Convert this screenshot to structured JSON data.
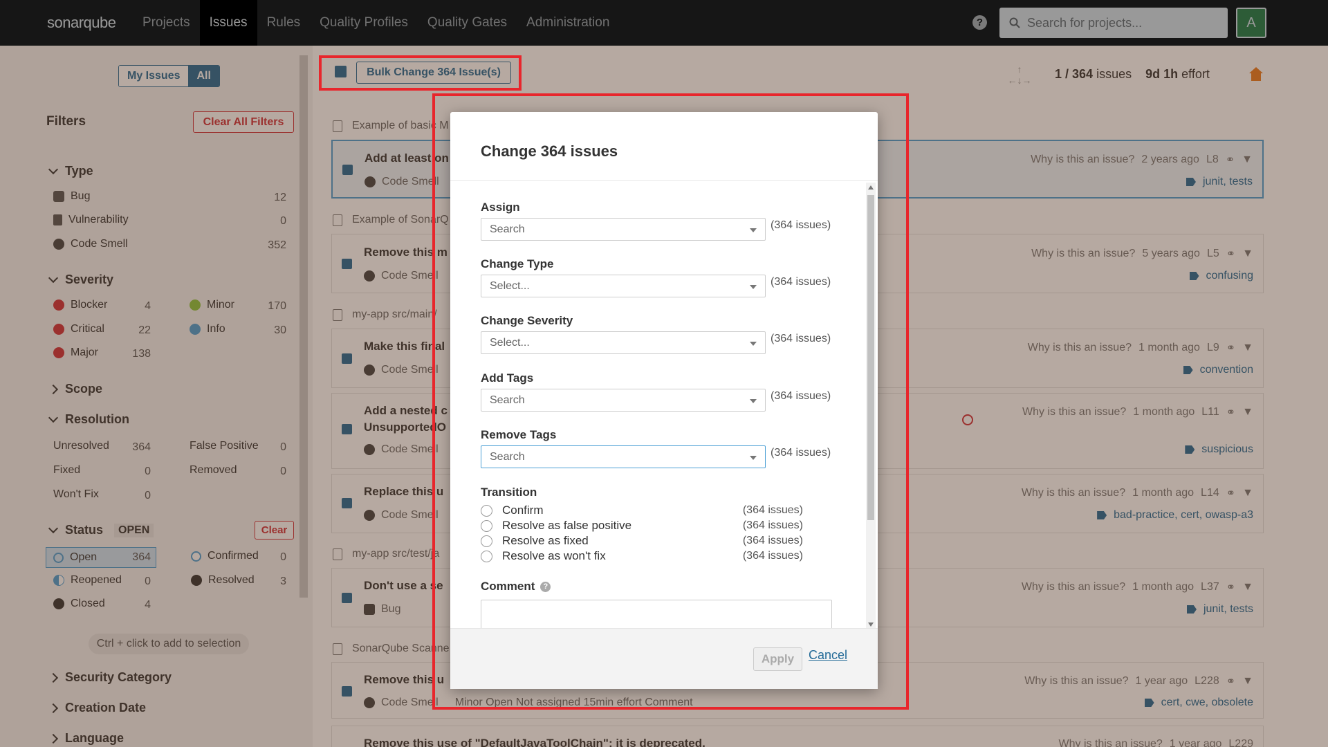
{
  "nav": {
    "logo": "sonarqube",
    "items": [
      "Projects",
      "Issues",
      "Rules",
      "Quality Profiles",
      "Quality Gates",
      "Administration"
    ],
    "search_placeholder": "Search for projects...",
    "avatar": "A"
  },
  "sidebar": {
    "my_issues": "My Issues",
    "all": "All",
    "filters": "Filters",
    "clear_all": "Clear All Filters",
    "type": {
      "title": "Type",
      "items": [
        {
          "label": "Bug",
          "count": "12"
        },
        {
          "label": "Vulnerability",
          "count": "0"
        },
        {
          "label": "Code Smell",
          "count": "352"
        }
      ]
    },
    "severity": {
      "title": "Severity",
      "items": [
        {
          "label": "Blocker",
          "count": "4"
        },
        {
          "label": "Minor",
          "count": "170"
        },
        {
          "label": "Critical",
          "count": "22"
        },
        {
          "label": "Info",
          "count": "30"
        },
        {
          "label": "Major",
          "count": "138"
        }
      ]
    },
    "scope": "Scope",
    "resolution": {
      "title": "Resolution",
      "items": [
        {
          "label": "Unresolved",
          "count": "364"
        },
        {
          "label": "False Positive",
          "count": "0"
        },
        {
          "label": "Fixed",
          "count": "0"
        },
        {
          "label": "Removed",
          "count": "0"
        },
        {
          "label": "Won't Fix",
          "count": "0"
        }
      ]
    },
    "status": {
      "title": "Status",
      "badge": "OPEN",
      "clear": "Clear",
      "items": [
        {
          "label": "Open",
          "count": "364"
        },
        {
          "label": "Confirmed",
          "count": "0"
        },
        {
          "label": "Reopened",
          "count": "0"
        },
        {
          "label": "Resolved",
          "count": "3"
        },
        {
          "label": "Closed",
          "count": "4"
        }
      ]
    },
    "hint": "Ctrl + click to add to selection",
    "security_category": "Security Category",
    "creation_date": "Creation Date",
    "language": "Language"
  },
  "toolbar": {
    "bulk_change": "Bulk Change 364 Issue(s)",
    "count_pos": "1",
    "count_total": "364",
    "count_word": "issues",
    "effort": "9d 1h",
    "effort_word": "effort"
  },
  "issues": {
    "files": [
      "Example of basic M",
      "Example of SonarQ",
      "my-app   src/main/",
      "my-app   src/test/ja",
      "SonarQube Scanne"
    ],
    "why": "Why is this an issue?",
    "list": [
      {
        "msg": "Add at least on",
        "type": "Code Smell",
        "age": "2 years ago",
        "line": "L8",
        "tags": "junit, tests"
      },
      {
        "msg": "Remove this m",
        "type": "Code Smell",
        "age": "5 years ago",
        "line": "L5",
        "tags": "confusing"
      },
      {
        "msg": "Make this final",
        "type": "Code Smell",
        "age": "1 month ago",
        "line": "L9",
        "tags": "convention"
      },
      {
        "msg": "Add a nested c",
        "msg2": "UnsupportedO",
        "type": "Code Smell",
        "age": "1 month ago",
        "line": "L11",
        "tags": "suspicious"
      },
      {
        "msg": "Replace this u",
        "type": "Code Smell",
        "age": "1 month ago",
        "line": "L14",
        "tags": "bad-practice, cert, owasp-a3"
      },
      {
        "msg": "Don't use a se",
        "type": "Bug",
        "age": "1 month ago",
        "line": "L37",
        "tags": "junit, tests"
      },
      {
        "msg": "Remove this u",
        "type": "Code Smell",
        "age": "1 year ago",
        "line": "L228",
        "tags": "cert, cwe, obsolete",
        "extra": "Minor   Open   Not assigned   15min effort   Comment"
      },
      {
        "msg": "Remove this use of \"DefaultJavaToolChain\"; it is deprecated.",
        "type": "",
        "age": "1 year ago",
        "line": "L229",
        "tags": ""
      }
    ]
  },
  "modal": {
    "title": "Change 364 issues",
    "count": "(364 issues)",
    "assign": {
      "label": "Assign",
      "placeholder": "Search"
    },
    "change_type": {
      "label": "Change Type",
      "placeholder": "Select..."
    },
    "change_severity": {
      "label": "Change Severity",
      "placeholder": "Select..."
    },
    "add_tags": {
      "label": "Add Tags",
      "placeholder": "Search"
    },
    "remove_tags": {
      "label": "Remove Tags",
      "placeholder": "Search"
    },
    "transition": {
      "label": "Transition",
      "options": [
        "Confirm",
        "Resolve as false positive",
        "Resolve as fixed",
        "Resolve as won't fix"
      ]
    },
    "comment": "Comment",
    "apply": "Apply",
    "cancel": "Cancel"
  },
  "colors": {
    "accent": "#236a97",
    "highlight": "#e8262c",
    "topbar": "#262626"
  }
}
